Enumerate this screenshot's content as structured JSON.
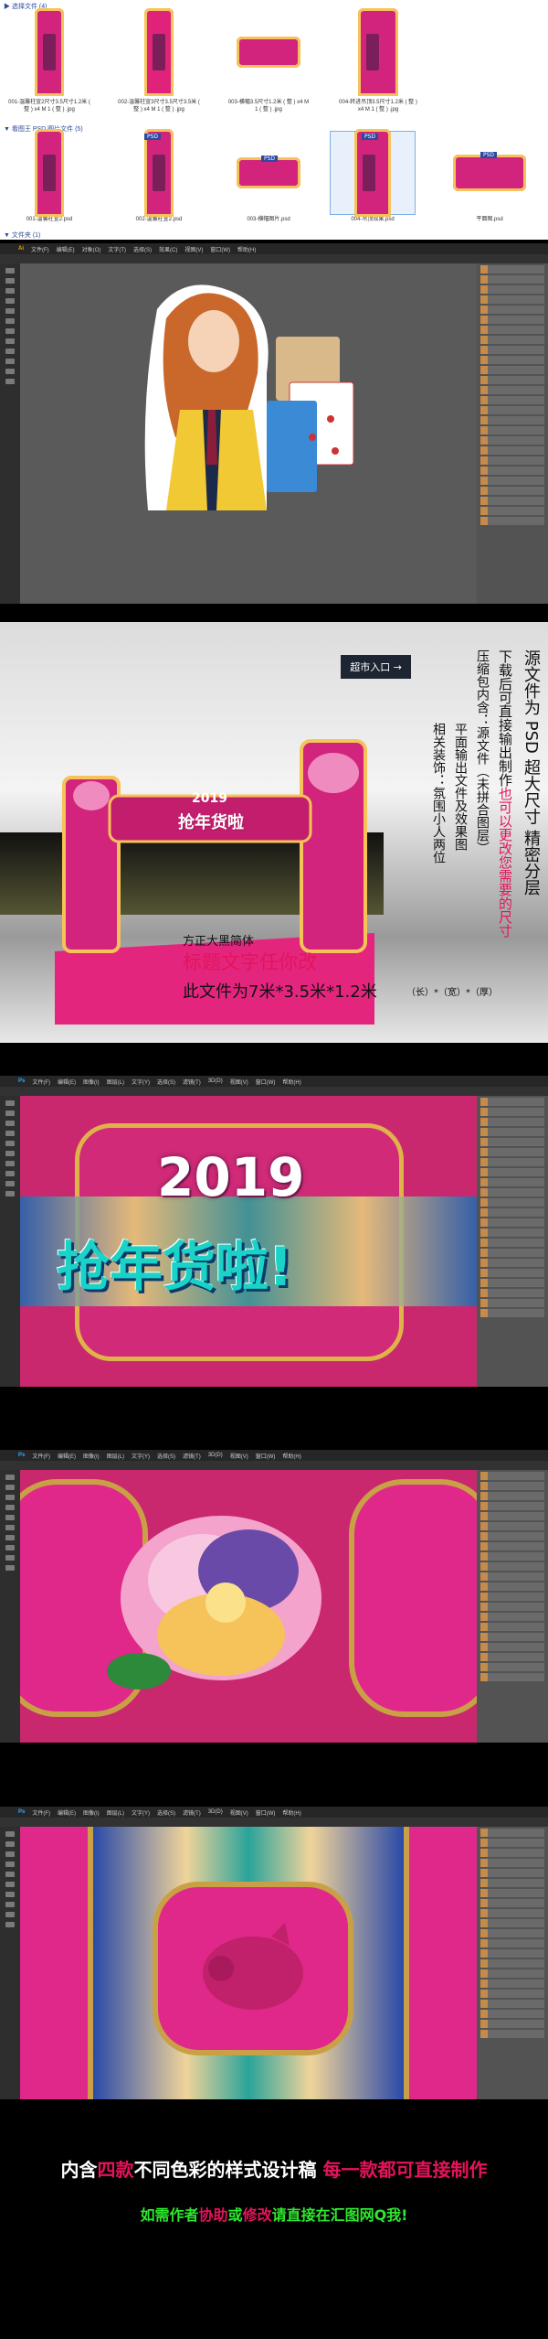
{
  "explorer": {
    "section1_label": "▶ 选择文件 (4)",
    "section2_label": "▼ 看图王 PSD 图片文件 (5)",
    "section3_label": "▼ 文件夹 (1)",
    "row1": [
      {
        "caption": "001-温馨柱宣2尺寸3.5尺寸1.2米 ( 整 ) x4 M 1 ( 整 ) .jpg"
      },
      {
        "caption": "002-温馨柱宣3尺寸3.5尺寸3.5米 ( 整 ) x4 M 1 ( 整 ) .jpg"
      },
      {
        "caption": "003-横幅3.5尺寸1.2米 ( 整 ) x4 M 1 ( 整 ) .jpg"
      },
      {
        "caption": "004-转进吊顶3.5尺寸1.2米 ( 整 ) x4 M 1 ( 整 ) .jpg"
      }
    ],
    "row2": [
      {
        "caption": "001-温馨柱宣2.psd",
        "badge": ""
      },
      {
        "caption": "002-温馨柱宣2.psd",
        "badge": "PSD"
      },
      {
        "caption": "003-横幅图片.psd",
        "badge": "PSD"
      },
      {
        "caption": "004-吊顶效果.psd",
        "badge": "PSD"
      },
      {
        "caption": "平面图.psd",
        "badge": "PSD"
      }
    ]
  },
  "illustrator": {
    "menu": [
      "Ai",
      "文件(F)",
      "编辑(E)",
      "对象(O)",
      "文字(T)",
      "选择(S)",
      "效果(C)",
      "视图(V)",
      "窗口(W)",
      "帮助(H)"
    ]
  },
  "render": {
    "ceiling_sign": "超市入口 →",
    "banner_year": "2019",
    "banner_slogan": "抢年货啦",
    "right_col1": "源文件为 PSD 超大尺寸 精密分层",
    "right_col2_a": "下载后可直接输出制作",
    "right_col2_b": "也可以更改您需要的尺寸",
    "right_col3": "压缩包内含：源文件（未拼合图层）",
    "right_col4": "平面输出文件及效果图",
    "right_col5": "相关装饰：氛围小人两位",
    "font_note": "方正大黑简体",
    "title_note": "标题文字任你改",
    "size_note": "此文件为7米*3.5米*1.2米",
    "size_units": "（长）*（宽）*（厚）"
  },
  "ps1": {
    "menu": [
      "Ps",
      "文件(F)",
      "编辑(E)",
      "图像(I)",
      "图层(L)",
      "文字(Y)",
      "选择(S)",
      "滤镜(T)",
      "3D(D)",
      "视图(V)",
      "窗口(W)",
      "帮助(H)"
    ],
    "year": "2019",
    "slogan": "抢年货啦!"
  },
  "ps2": {
    "menu": [
      "Ps",
      "文件(F)",
      "编辑(E)",
      "图像(I)",
      "图层(L)",
      "文字(Y)",
      "选择(S)",
      "滤镜(T)",
      "3D(D)",
      "视图(V)",
      "窗口(W)",
      "帮助(H)"
    ]
  },
  "ps3": {
    "menu": [
      "Ps",
      "文件(F)",
      "编辑(E)",
      "图像(I)",
      "图层(L)",
      "文字(Y)",
      "选择(S)",
      "滤镜(T)",
      "3D(D)",
      "视图(V)",
      "窗口(W)",
      "帮助(H)"
    ]
  },
  "footer": {
    "line1_a": "内含",
    "line1_b": "四款",
    "line1_c": "不同色彩的样式设计稿",
    "line1_d": "每一款都可直接制作",
    "line2_a": "如需作者",
    "line2_b": "协助",
    "line2_c": "或",
    "line2_d": "修改",
    "line2_e": "请直接在汇图网Q我!"
  },
  "colors": {
    "magenta": "#d2247c",
    "gold": "#f6c25a",
    "red_text": "#e4145a",
    "teal": "#1bd2c7"
  }
}
